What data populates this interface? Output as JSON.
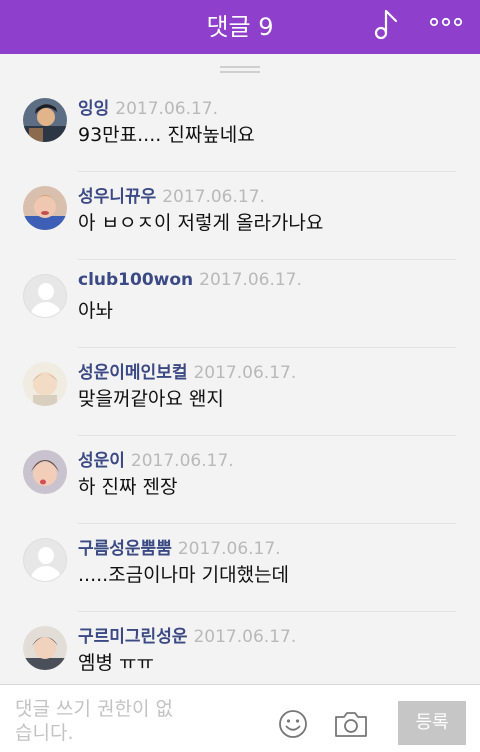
{
  "header": {
    "title": "댓글 9",
    "music_icon": "music-note-icon",
    "more_icon": "more-dots-icon",
    "background_color": "#8e3fcb"
  },
  "comments": [
    {
      "author": "잉잉",
      "date": "2017.06.17.",
      "text": "93만표.... 진짜높네요",
      "avatar": "photo"
    },
    {
      "author": "성우니뀨우",
      "date": "2017.06.17.",
      "text": "아 ㅂㅇㅈ이 저렇게 올라가나요",
      "avatar": "photo"
    },
    {
      "author": "club100won",
      "date": "2017.06.17.",
      "text": "아놔",
      "avatar": "default"
    },
    {
      "author": "성운이메인보컬",
      "date": "2017.06.17.",
      "text": "맞을꺼같아요 왠지",
      "avatar": "photo"
    },
    {
      "author": "성운이",
      "date": "2017.06.17.",
      "text": "하 진짜 젠장",
      "avatar": "photo"
    },
    {
      "author": "구름성운뿜뿜",
      "date": "2017.06.17.",
      "text": ".....조금이나마 기대했는데",
      "avatar": "default"
    },
    {
      "author": "구르미그린성운",
      "date": "2017.06.17.",
      "text": "옘병 ㅠㅠ",
      "avatar": "photo"
    }
  ],
  "footer": {
    "placeholder": "댓글 쓰기 권한이 없습니다.",
    "emoji_icon": "smiley-icon",
    "camera_icon": "camera-icon",
    "submit_label": "등록"
  },
  "colors": {
    "author": "#3b4a84",
    "date": "#b9b9b9"
  }
}
